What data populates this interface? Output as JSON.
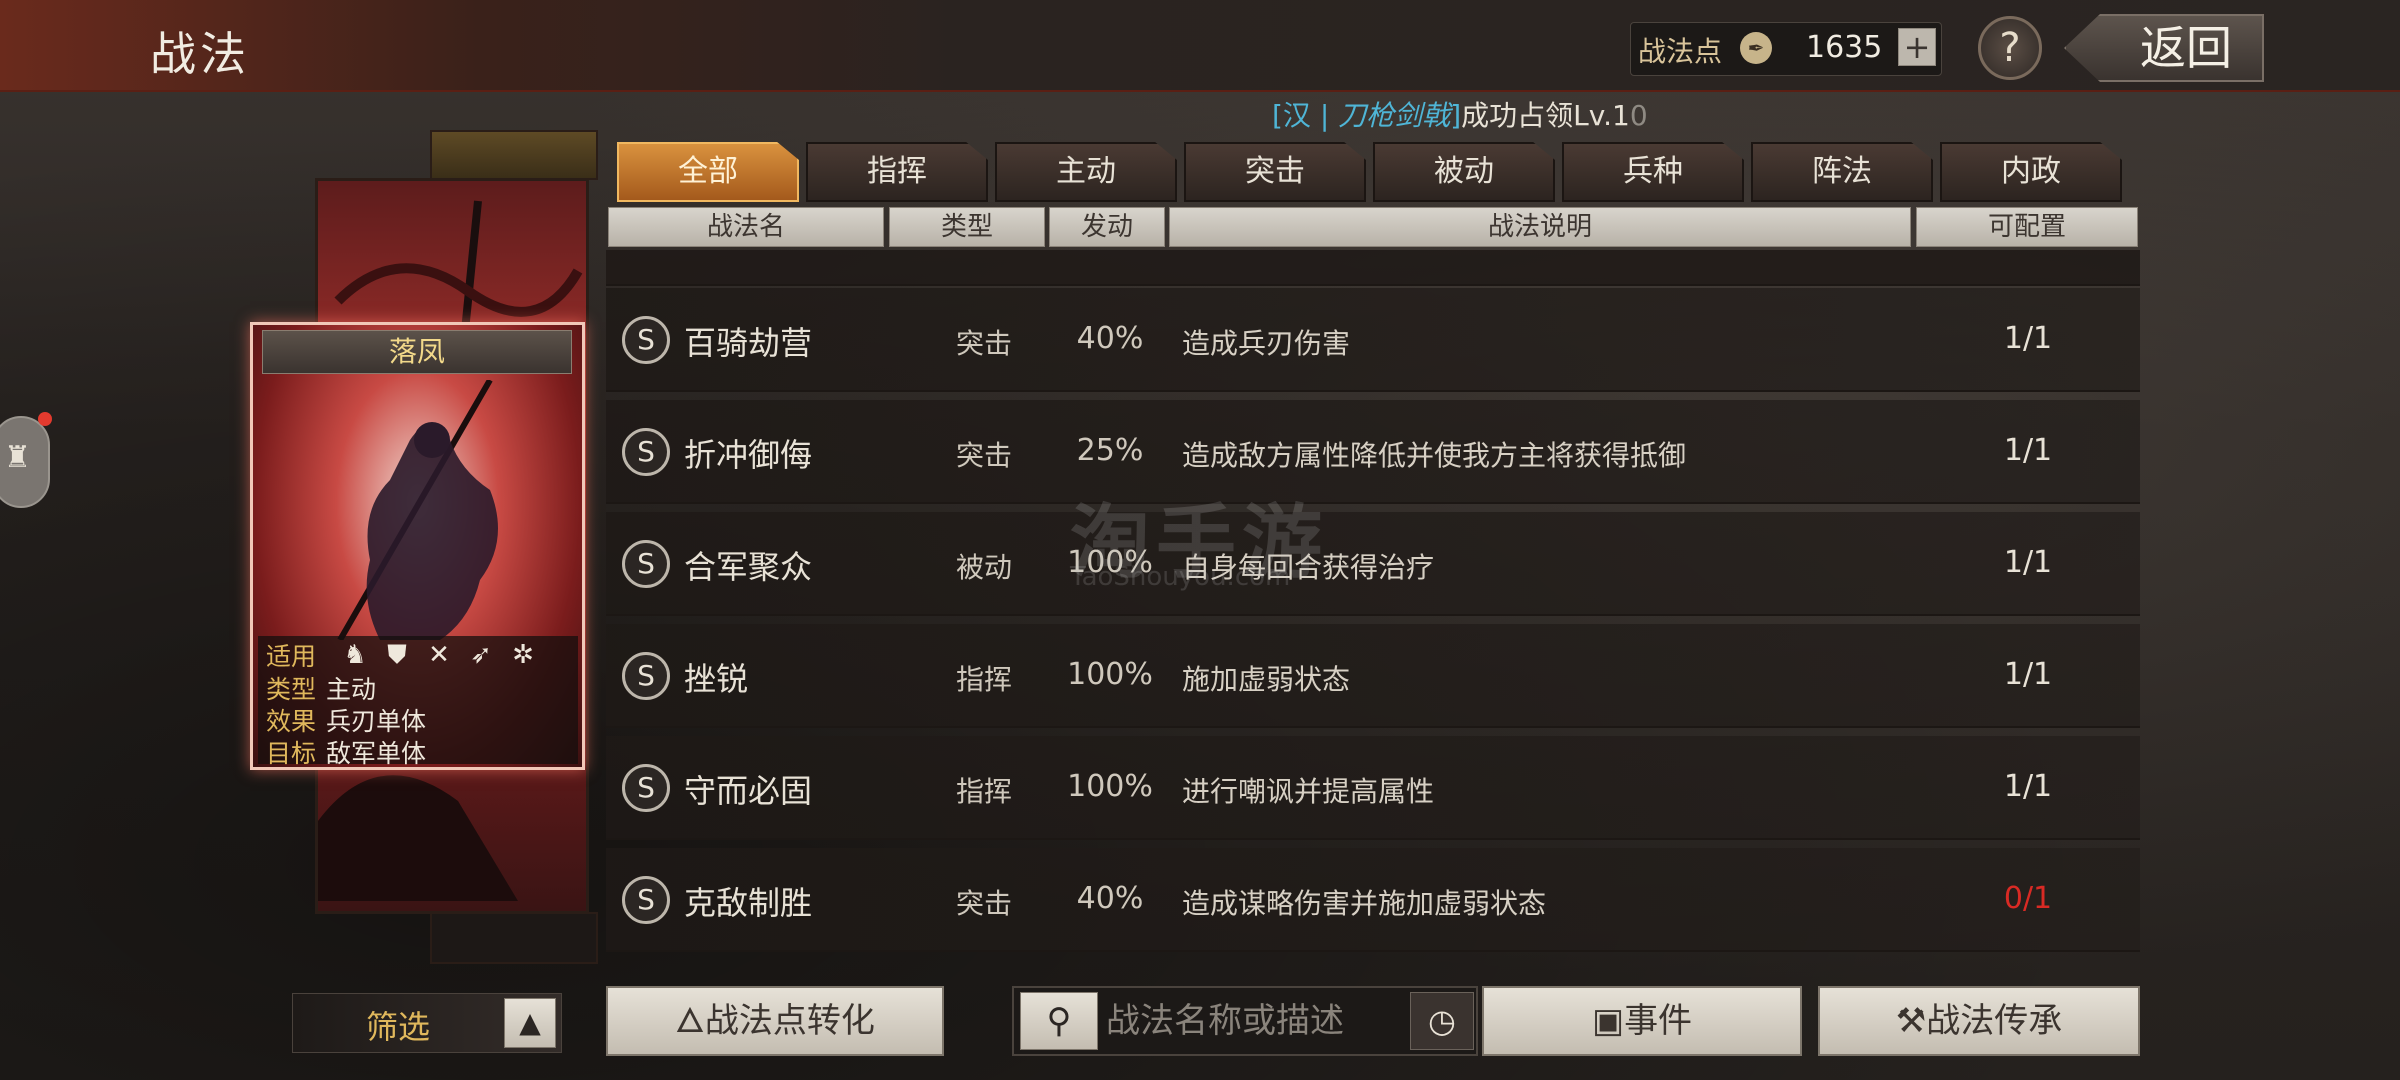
{
  "header": {
    "title": "战法",
    "points_label": "战法点",
    "points_value": "1635",
    "plus": "+",
    "help": "?",
    "back": "返回"
  },
  "announcement": {
    "prefix": "[汉 | ",
    "team": "刀枪剑戟",
    "suffix_bracket": "]",
    "text": "成功占领Lv.1",
    "faded": "0"
  },
  "card": {
    "name": "落凤",
    "applies_label": "适用",
    "type_label": "类型",
    "type_value": "主动",
    "effect_label": "效果",
    "effect_value": "兵刃单体",
    "target_label": "目标",
    "target_value": "敌军单体",
    "unit_icons": [
      "cavalry-icon",
      "shield-icon",
      "bow-icon",
      "spear-icon",
      "wheel-icon"
    ]
  },
  "tabs": [
    "全部",
    "指挥",
    "主动",
    "突击",
    "被动",
    "兵种",
    "阵法",
    "内政"
  ],
  "active_tab": 0,
  "columns": {
    "name": "战法名",
    "type": "类型",
    "rate": "发动",
    "desc": "战法说明",
    "qty": "可配置"
  },
  "rows": [
    {
      "grade": "S",
      "name": "百骑劫营",
      "type": "突击",
      "rate": "40%",
      "desc": "造成兵刃伤害",
      "qty": "1/1"
    },
    {
      "grade": "S",
      "name": "折冲御侮",
      "type": "突击",
      "rate": "25%",
      "desc": "造成敌方属性降低并使我方主将获得抵御",
      "qty": "1/1"
    },
    {
      "grade": "S",
      "name": "合军聚众",
      "type": "被动",
      "rate": "100%",
      "desc": "自身每回合获得治疗",
      "qty": "1/1"
    },
    {
      "grade": "S",
      "name": "挫锐",
      "type": "指挥",
      "rate": "100%",
      "desc": "施加虚弱状态",
      "qty": "1/1"
    },
    {
      "grade": "S",
      "name": "守而必固",
      "type": "指挥",
      "rate": "100%",
      "desc": "进行嘲讽并提高属性",
      "qty": "1/1"
    },
    {
      "grade": "S",
      "name": "克敌制胜",
      "type": "突击",
      "rate": "40%",
      "desc": "造成谋略伤害并施加虚弱状态",
      "qty": "0/1"
    }
  ],
  "watermark": {
    "main": "淘手游",
    "sub": "TaoShouyou.com"
  },
  "bottom": {
    "filter": "筛选",
    "convert": "战法点转化",
    "search_placeholder": "战法名称或描述",
    "events": "事件",
    "inherit": "战法传承"
  },
  "colors": {
    "accent_tab": "#d9923e",
    "team_link": "#4fb5d6",
    "zero_qty": "#d92a24"
  }
}
